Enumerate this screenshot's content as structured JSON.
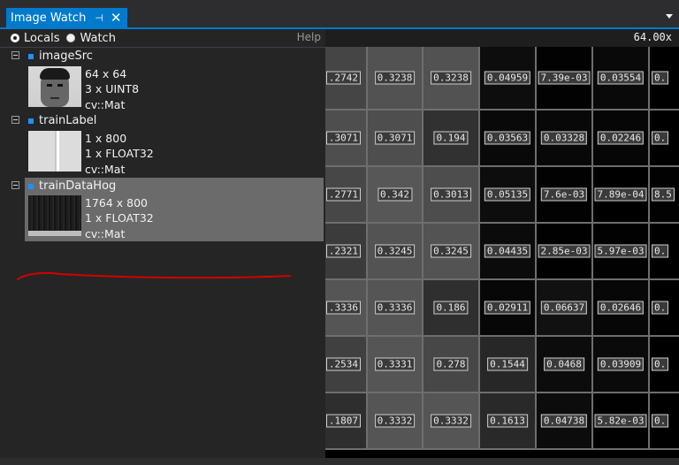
{
  "window": {
    "tab_title": "Image Watch",
    "pin_glyph": "⊣",
    "close_glyph": "✕"
  },
  "toolbar": {
    "locals_label": "Locals",
    "watch_label": "Watch",
    "help_label": "Help",
    "selected": "Locals"
  },
  "variables": [
    {
      "name": "imageSrc",
      "size": "64 x 64",
      "channels": "3 x UINT8",
      "type": "cv::Mat",
      "icon": "face-thumbnail"
    },
    {
      "name": "trainLabel",
      "size": "1 x 800",
      "channels": "1 x FLOAT32",
      "type": "cv::Mat",
      "icon": "label-thumbnail"
    },
    {
      "name": "trainDataHog",
      "size": "1764 x 800",
      "channels": "1 x FLOAT32",
      "type": "cv::Mat",
      "icon": "hog-thumbnail",
      "selected": true
    }
  ],
  "viewer": {
    "zoom": "64.00x",
    "rows": [
      [
        ".2742",
        "0.3238",
        "0.3238",
        "0.04959",
        "7.39e-03",
        "0.03554",
        "0."
      ],
      [
        ".3071",
        "0.3071",
        "0.194",
        "0.03563",
        "0.03328",
        "0.02246",
        "0."
      ],
      [
        ".2771",
        "0.342",
        "0.3013",
        "0.05135",
        "7.6e-03",
        "7.89e-04",
        "8.5"
      ],
      [
        ".2321",
        "0.3245",
        "0.3245",
        "0.04435",
        "2.85e-03",
        "5.97e-03",
        "0."
      ],
      [
        ".3336",
        "0.3336",
        "0.186",
        "0.02911",
        "0.06637",
        "0.02646",
        "0."
      ],
      [
        ".2534",
        "0.3331",
        "0.278",
        "0.1544",
        "0.0468",
        "0.03909",
        "0."
      ],
      [
        ".1807",
        "0.3332",
        "0.3332",
        "0.1613",
        "0.04738",
        "5.82e-03",
        "0."
      ]
    ],
    "shades": [
      [
        "#454545",
        "#525252",
        "#525252",
        "#0d0d0d",
        "#020202",
        "#090909",
        "#000000"
      ],
      [
        "#4e4e4e",
        "#4e4e4e",
        "#313131",
        "#090909",
        "#080808",
        "#060606",
        "#000000"
      ],
      [
        "#474747",
        "#575757",
        "#4d4d4d",
        "#0d0d0d",
        "#020202",
        "#000000",
        "#020202"
      ],
      [
        "#3b3b3b",
        "#535353",
        "#535353",
        "#0b0b0b",
        "#010101",
        "#020202",
        "#000000"
      ],
      [
        "#555555",
        "#555555",
        "#2f2f2f",
        "#070707",
        "#111111",
        "#070707",
        "#000000"
      ],
      [
        "#404040",
        "#555555",
        "#474747",
        "#272727",
        "#0c0c0c",
        "#0a0a0a",
        "#000000"
      ],
      [
        "#2e2e2e",
        "#555555",
        "#555555",
        "#292929",
        "#0c0c0c",
        "#010101",
        "#000000"
      ]
    ]
  },
  "annotation": {
    "color": "#d40000"
  }
}
